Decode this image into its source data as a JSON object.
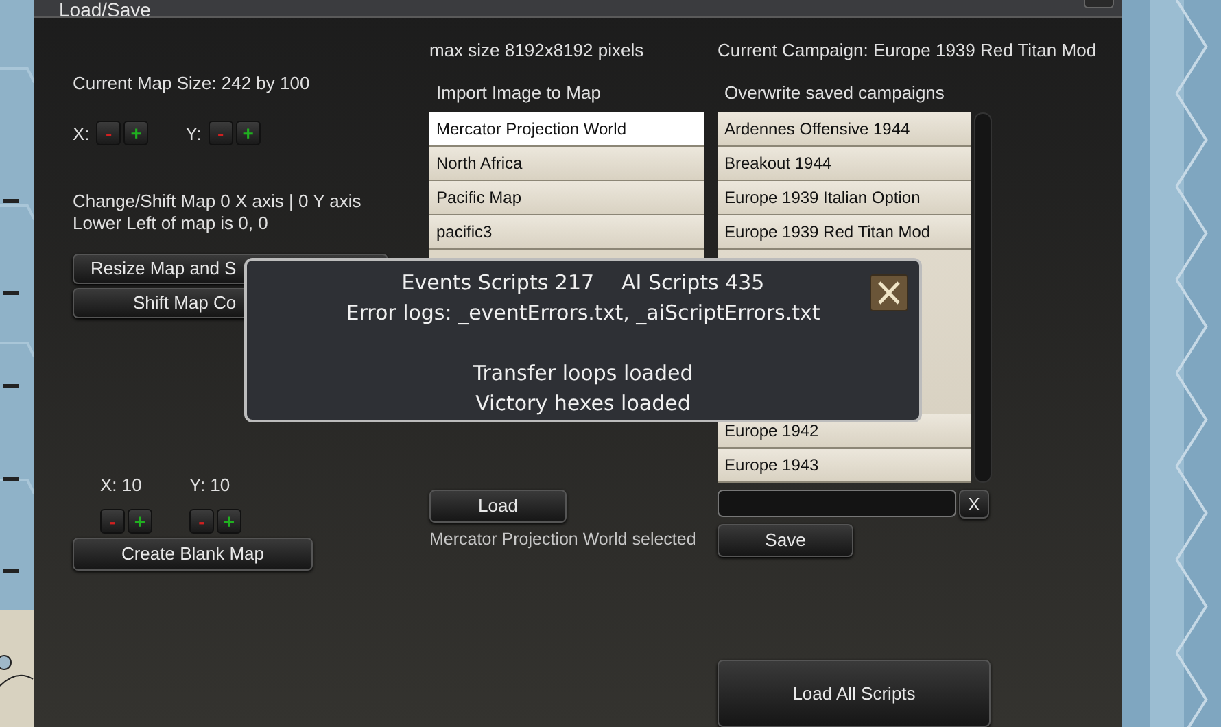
{
  "window": {
    "title": "Load/Save"
  },
  "map_size": {
    "label": "Current Map Size: 242 by 100",
    "steppers": [
      {
        "label": "X:",
        "minus": "-",
        "plus": "+"
      },
      {
        "label": "Y:",
        "minus": "-",
        "plus": "+"
      }
    ]
  },
  "shift_info": [
    "Change/Shift Map 0 X axis | 0 Y axis",
    "Lower Left of map is 0, 0"
  ],
  "map_buttons": [
    "Resize Map and S",
    "Shift Map Co"
  ],
  "blank_map": {
    "steppers": [
      {
        "label": "X: 10",
        "minus": "-",
        "plus": "+"
      },
      {
        "label": "Y: 10",
        "minus": "-",
        "plus": "+"
      }
    ],
    "button": "Create Blank Map"
  },
  "import": {
    "note": "max size 8192x8192 pixels",
    "title": "Import Image to Map",
    "items": [
      {
        "label": "Mercator Projection World",
        "selected": true
      },
      {
        "label": "North Africa",
        "selected": false
      },
      {
        "label": "Pacific Map",
        "selected": false
      },
      {
        "label": "pacific3",
        "selected": false
      }
    ],
    "load_button": "Load",
    "status": "Mercator Projection World selected"
  },
  "campaigns": {
    "current": "Current Campaign: Europe 1939 Red Titan Mod",
    "title": "Overwrite saved campaigns",
    "items_top": [
      {
        "label": "Ardennes Offensive 1944",
        "selected": false
      },
      {
        "label": "Breakout 1944",
        "selected": false
      },
      {
        "label": "Europe 1939 Italian Option",
        "selected": false
      },
      {
        "label": "Europe 1939 Red Titan Mod",
        "selected": false
      }
    ],
    "items_bottom": [
      {
        "label": "Europe 1942",
        "selected": false
      },
      {
        "label": "Europe 1943",
        "selected": false
      }
    ],
    "clear_button": "X",
    "save_button": "Save"
  },
  "load_all_button": "Load All Scripts",
  "dialog": {
    "summary": [
      "Events Scripts 217",
      "AI Scripts 435"
    ],
    "error_logs": "Error logs: _eventErrors.txt, _aiScriptErrors.txt",
    "messages": [
      "Transfer loops loaded",
      "Victory hexes loaded"
    ]
  }
}
